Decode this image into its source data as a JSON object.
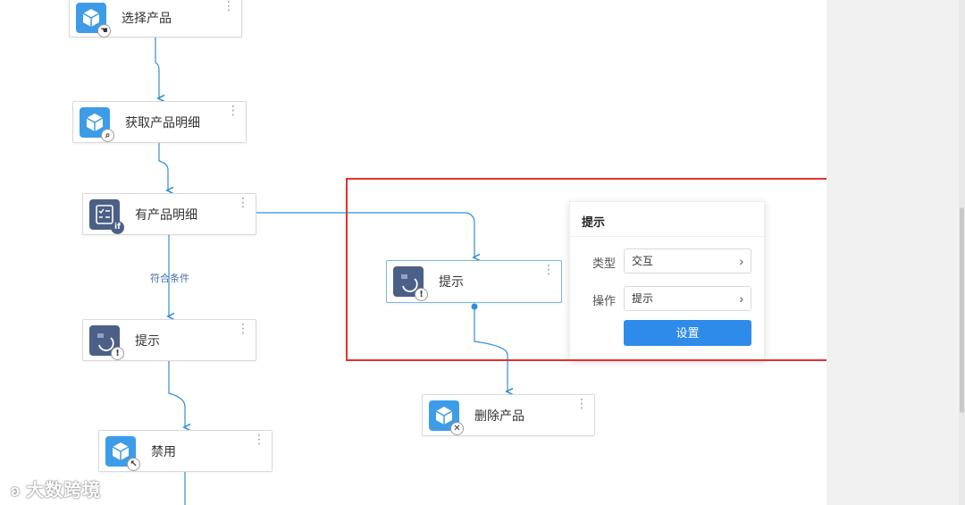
{
  "flow": {
    "nodes": [
      {
        "label": "选择产品",
        "icon": "cube-pointer-icon"
      },
      {
        "label": "获取产品明细",
        "icon": "cube-search-icon"
      },
      {
        "label": "有产品明细",
        "icon": "if-condition-icon"
      },
      {
        "label": "提示",
        "icon": "loop-alert-icon"
      },
      {
        "label": "禁用",
        "icon": "cube-disable-icon"
      },
      {
        "label": "提示",
        "icon": "loop-alert-icon"
      },
      {
        "label": "删除产品",
        "icon": "cube-delete-icon"
      }
    ],
    "condition_label": "符合条件"
  },
  "popover": {
    "title": "提示",
    "type_label": "类型",
    "type_value": "交互",
    "action_label": "操作",
    "action_value": "提示",
    "button_label": "设置"
  },
  "colors": {
    "connector": "#2f8fd6",
    "highlight": "#e0332b",
    "button": "#2f8be9",
    "icon_blue": "#3d9ce8",
    "icon_slate": "#4c5f86"
  },
  "watermark": "大数跨境"
}
